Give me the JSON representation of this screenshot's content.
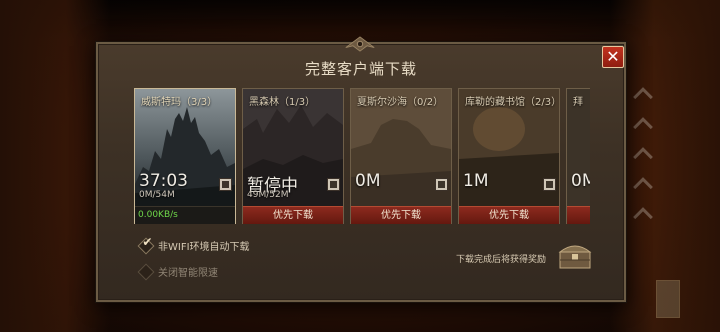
{
  "panel": {
    "title": "完整客户端下载",
    "close_label": "✕"
  },
  "cards": [
    {
      "name": "威斯特玛（3/3）",
      "big": "37:03",
      "small": "0M/54M",
      "speed": "0.00KB/s",
      "selected": true
    },
    {
      "name": "黑森林（1/3）",
      "big": "暂停中",
      "small": "49M/52M",
      "button": "优先下载"
    },
    {
      "name": "夏斯尔沙海（0/2）",
      "big": "0M",
      "small": "",
      "button": "优先下载"
    },
    {
      "name": "库勒的藏书馆（2/3）",
      "big": "1M",
      "small": "",
      "button": "优先下载"
    },
    {
      "name": "拜",
      "big": "0M",
      "small": "",
      "button": ""
    }
  ],
  "options": {
    "auto_download_non_wifi": {
      "label": "非WIFI环境自动下载",
      "checked": true
    },
    "disable_smart_limit": {
      "label": "关闭智能限速",
      "checked": false
    }
  },
  "reward": {
    "text": "下载完成后将获得奖励"
  },
  "colors": {
    "button_red": "#8c2a1e",
    "speed_green": "#6fd84a",
    "close_red": "#c2331f",
    "panel_bg": "#3d3125"
  }
}
